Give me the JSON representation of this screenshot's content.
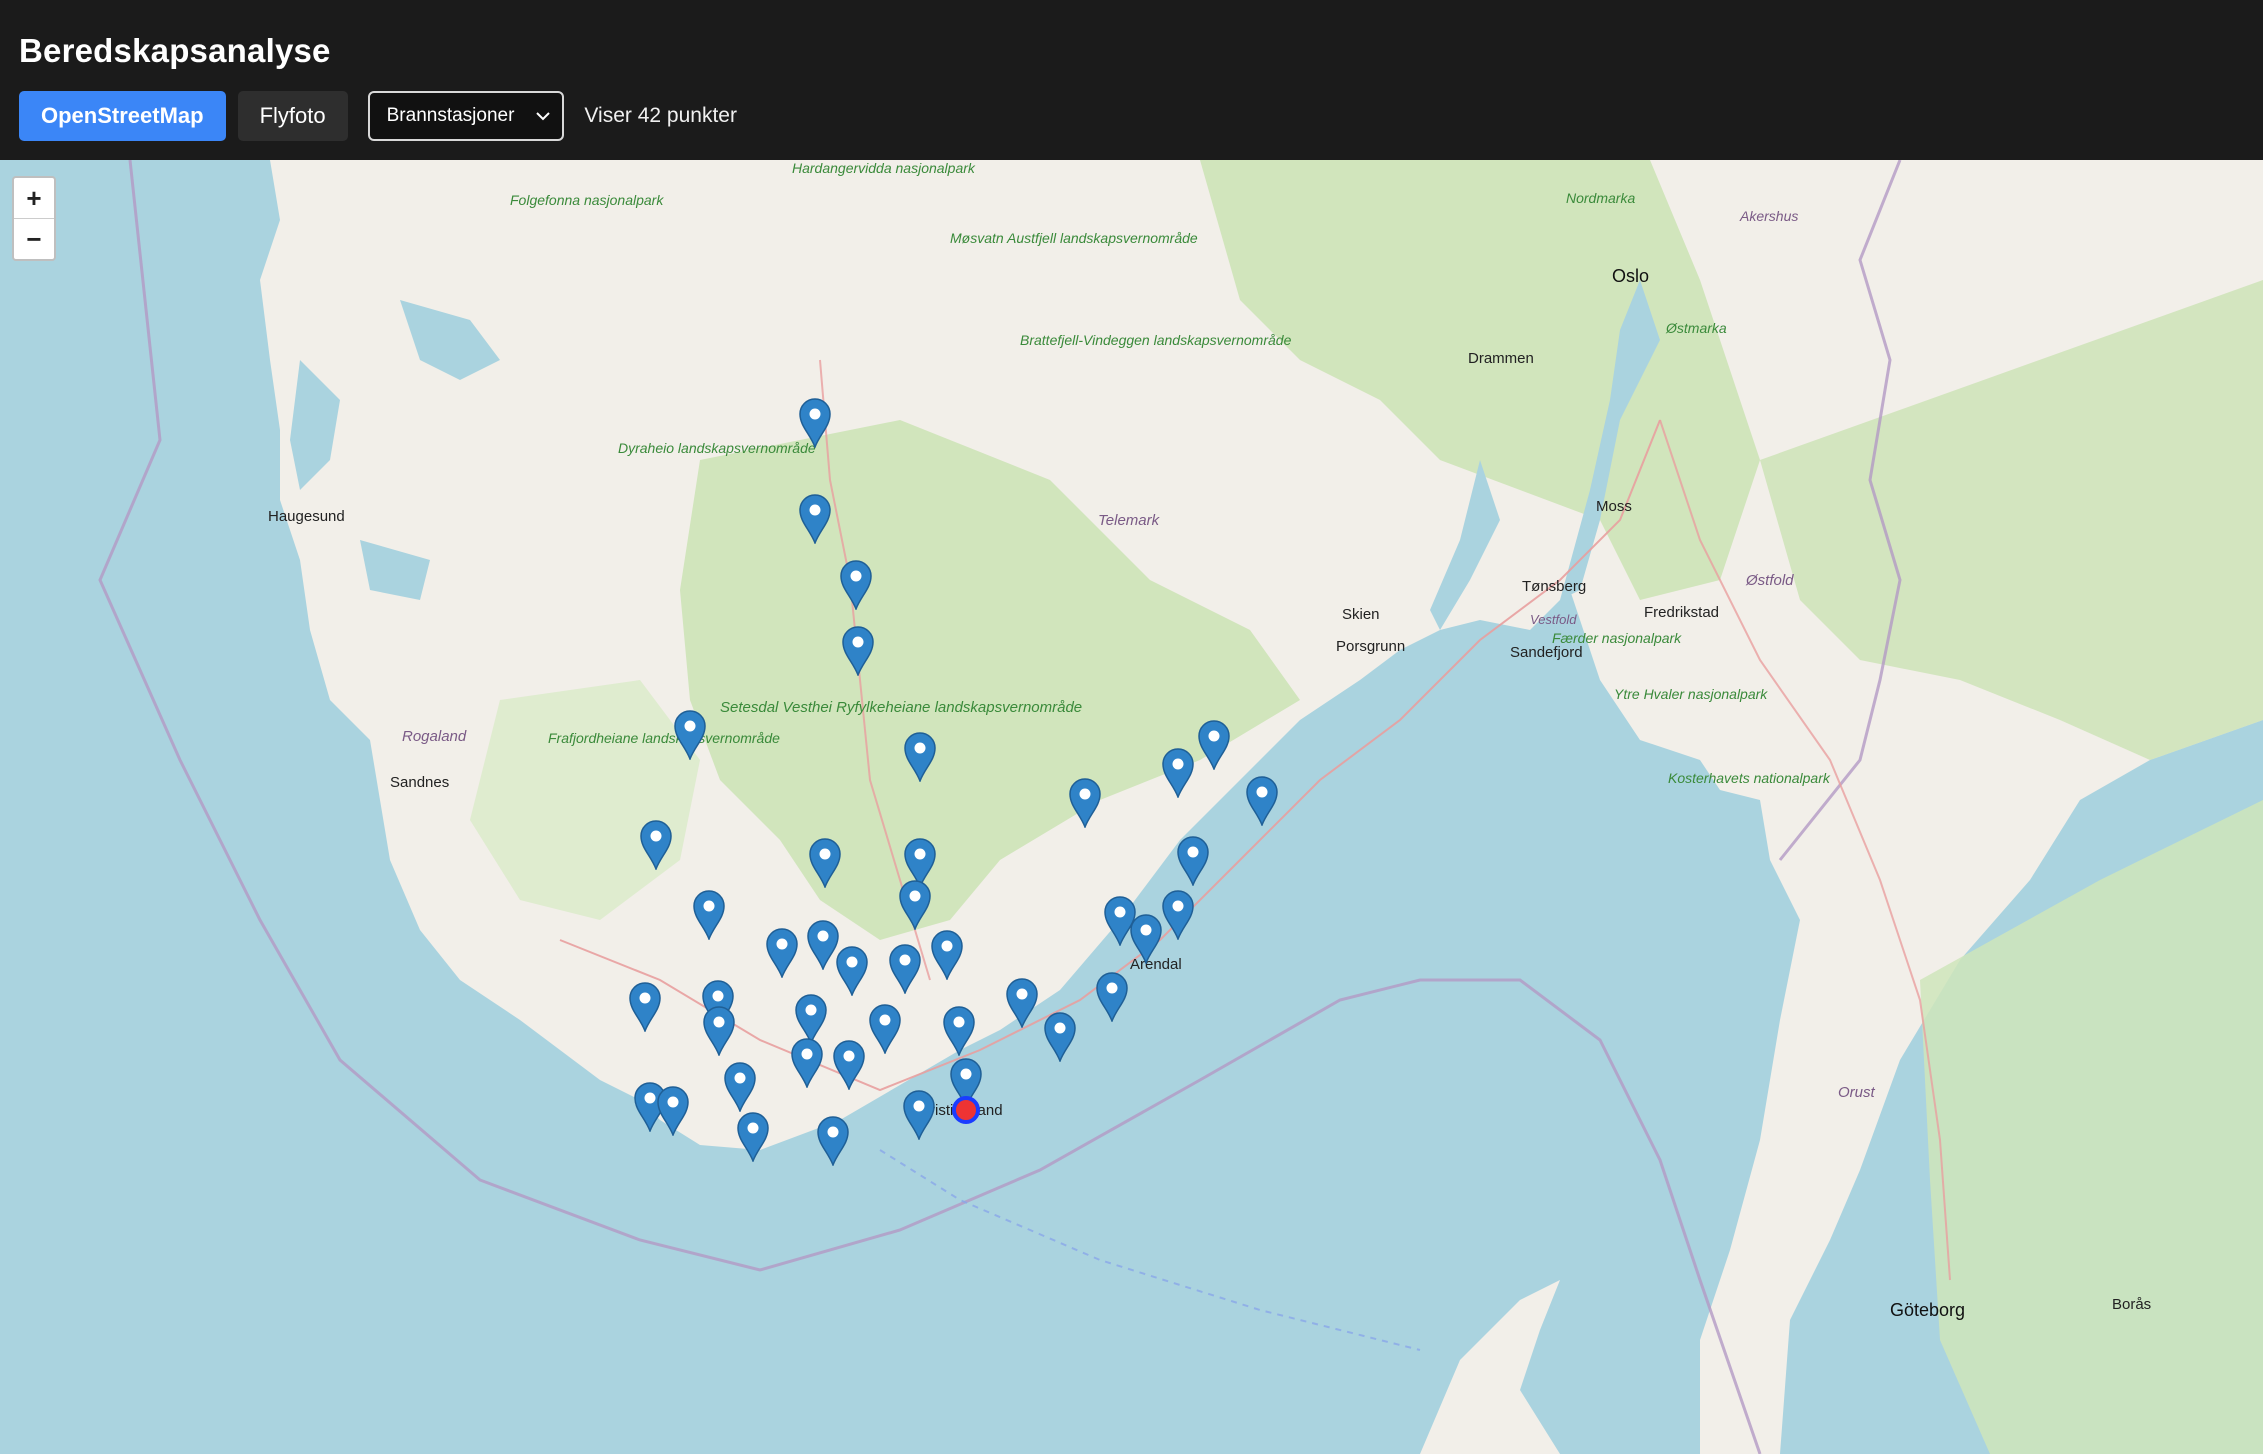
{
  "app": {
    "title": "Beredskapsanalyse"
  },
  "toolbar": {
    "osm_label": "OpenStreetMap",
    "aerial_label": "Flyfoto",
    "layer_select_value": "Brannstasjoner",
    "count_text": "Viser 42 punkter"
  },
  "map_controls": {
    "zoom_in": "+",
    "zoom_out": "−"
  },
  "colors": {
    "accent": "#3b86f7",
    "marker": "#2f83c8",
    "target_ring": "#1a3cff",
    "water": "#aad3df",
    "land": "#f2efe9",
    "forest": "#c8e2b0"
  },
  "map_labels": {
    "hardangervidda": "Hardangervidda nasjonalpark",
    "folgefonna": "Folgefonna nasjonalpark",
    "mosvatn": "Møsvatn Austfjell landskapsvernområde",
    "brattefjell": "Brattefjell-Vindeggen landskapsvernområde",
    "dyraheio": "Dyraheio landskapsvernområde",
    "setesdal": "Setesdal Vesthei Ryfylkeheiane landskapsvernområde",
    "frafjord": "Frafjordheiane landskapsvernområde",
    "haugesund": "Haugesund",
    "rogaland": "Rogaland",
    "sandnes": "Sandnes",
    "telemark": "Telemark",
    "skien": "Skien",
    "porsgrunn": "Porsgrunn",
    "sandefjord": "Sandefjord",
    "tonsberg": "Tønsberg",
    "vestfold": "Vestfold",
    "drammen": "Drammen",
    "oslo": "Oslo",
    "nordmarka": "Nordmarka",
    "akershus": "Akershus",
    "ostmarka": "Østmarka",
    "moss": "Moss",
    "fredrikstad": "Fredrikstad",
    "ostfold": "Østfold",
    "faerder": "Færder nasjonalpark",
    "ytre_hvaler": "Ytre Hvaler nasjonalpark",
    "kosterhavets": "Kosterhavets nationalpark",
    "arendal": "Arendal",
    "kristiansand": "Kristiansand",
    "orust": "Orust",
    "goteborg": "Göteborg",
    "boras": "Borås"
  },
  "markers": [
    "Brannstasjon 1",
    "Brannstasjon 2",
    "Brannstasjon 3",
    "Brannstasjon 4",
    "Brannstasjon 5",
    "Brannstasjon 6",
    "Brannstasjon 7",
    "Brannstasjon 8",
    "Brannstasjon 9",
    "Brannstasjon 10",
    "Brannstasjon 11",
    "Brannstasjon 12",
    "Brannstasjon 13",
    "Brannstasjon 14",
    "Brannstasjon 15",
    "Brannstasjon 16",
    "Brannstasjon 17",
    "Brannstasjon 18",
    "Brannstasjon 19",
    "Brannstasjon 20",
    "Brannstasjon 21",
    "Brannstasjon 22",
    "Brannstasjon 23",
    "Brannstasjon 24",
    "Brannstasjon 25",
    "Brannstasjon 26",
    "Brannstasjon 27",
    "Brannstasjon 28",
    "Brannstasjon 29",
    "Brannstasjon 30",
    "Brannstasjon 31",
    "Brannstasjon 32",
    "Brannstasjon 33",
    "Brannstasjon 34",
    "Brannstasjon 35",
    "Brannstasjon 36",
    "Brannstasjon 37",
    "Brannstasjon 38",
    "Brannstasjon 39",
    "Brannstasjon 40",
    "Brannstasjon 41",
    "Brannstasjon 42"
  ]
}
